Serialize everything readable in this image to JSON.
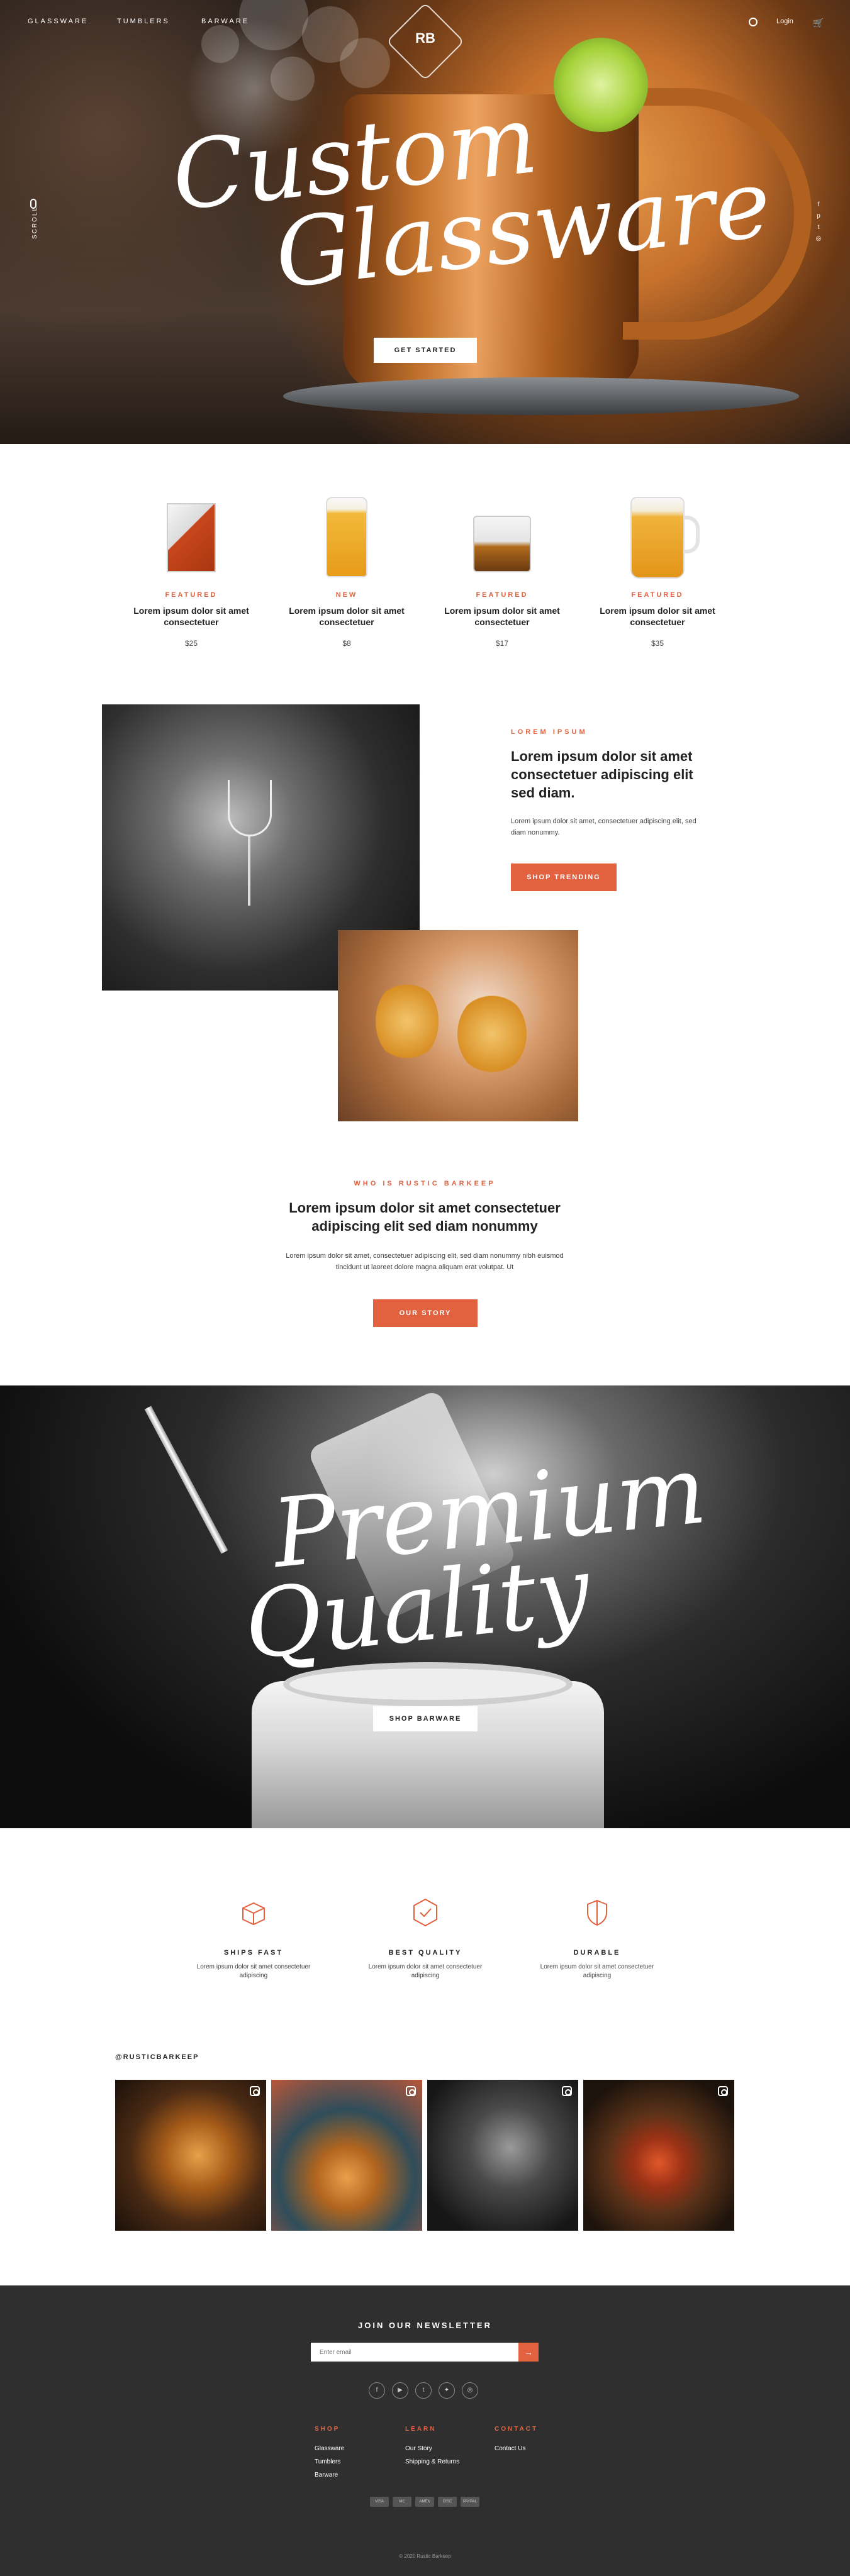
{
  "nav": {
    "left": [
      "GLASSWARE",
      "TUMBLERS",
      "BARWARE"
    ],
    "logo": "RB",
    "login": "Login"
  },
  "hero": {
    "title_line1": "Custom",
    "title_line2": "Glassware",
    "cta": "GET STARTED",
    "side_text": "SCROLL"
  },
  "products": [
    {
      "tag": "FEATURED",
      "name": "Lorem ipsum dolor sit amet consectetuer",
      "price": "$25"
    },
    {
      "tag": "NEW",
      "name": "Lorem ipsum dolor sit amet consectetuer",
      "price": "$8"
    },
    {
      "tag": "FEATURED",
      "name": "Lorem ipsum dolor sit amet consectetuer",
      "price": "$17"
    },
    {
      "tag": "FEATURED",
      "name": "Lorem ipsum dolor sit amet consectetuer",
      "price": "$35"
    }
  ],
  "feature": {
    "eyebrow": "LOREM IPSUM",
    "heading": "Lorem ipsum dolor sit amet consectetuer adipiscing elit sed diam.",
    "body": "Lorem ipsum dolor sit amet, consectetuer adipiscing elit, sed diam nonummy.",
    "cta": "SHOP TRENDING"
  },
  "about": {
    "eyebrow": "WHO IS RUSTIC BARKEEP",
    "heading": "Lorem ipsum dolor sit amet consectetuer adipiscing elit sed diam nonummy",
    "body": "Lorem ipsum dolor sit amet, consectetuer adipiscing elit, sed diam nonummy nibh euismod tincidunt ut laoreet dolore magna aliquam erat volutpat. Ut",
    "cta": "OUR STORY"
  },
  "premium": {
    "title_line1": "Premium",
    "title_line2": "Quality",
    "cta": "SHOP BARWARE"
  },
  "benefits": [
    {
      "icon": "box-icon",
      "title": "SHIPS FAST",
      "desc": "Lorem ipsum dolor sit amet consectetuer adipiscing"
    },
    {
      "icon": "badge-check-icon",
      "title": "BEST QUALITY",
      "desc": "Lorem ipsum dolor sit amet consectetuer adipiscing"
    },
    {
      "icon": "shield-icon",
      "title": "DURABLE",
      "desc": "Lorem ipsum dolor sit amet consectetuer adipiscing"
    }
  ],
  "instagram": {
    "handle": "@RUSTICBARKEEP"
  },
  "newsletter": {
    "title": "JOIN OUR NEWSLETTER",
    "placeholder": "Enter email"
  },
  "footer": {
    "shop": {
      "heading": "SHOP",
      "items": [
        "Glassware",
        "Tumblers",
        "Barware"
      ]
    },
    "learn": {
      "heading": "LEARN",
      "items": [
        "Our Story",
        "Shipping & Returns"
      ]
    },
    "contact": {
      "heading": "CONTACT",
      "items": [
        "Contact Us"
      ]
    },
    "copyright": "© 2020 Rustic Barkeep",
    "payments": [
      "VISA",
      "MC",
      "AMEX",
      "DISC",
      "PAYPAL"
    ]
  },
  "colors": {
    "accent": "#e2623f",
    "footer_bg": "#2f2f2f"
  }
}
